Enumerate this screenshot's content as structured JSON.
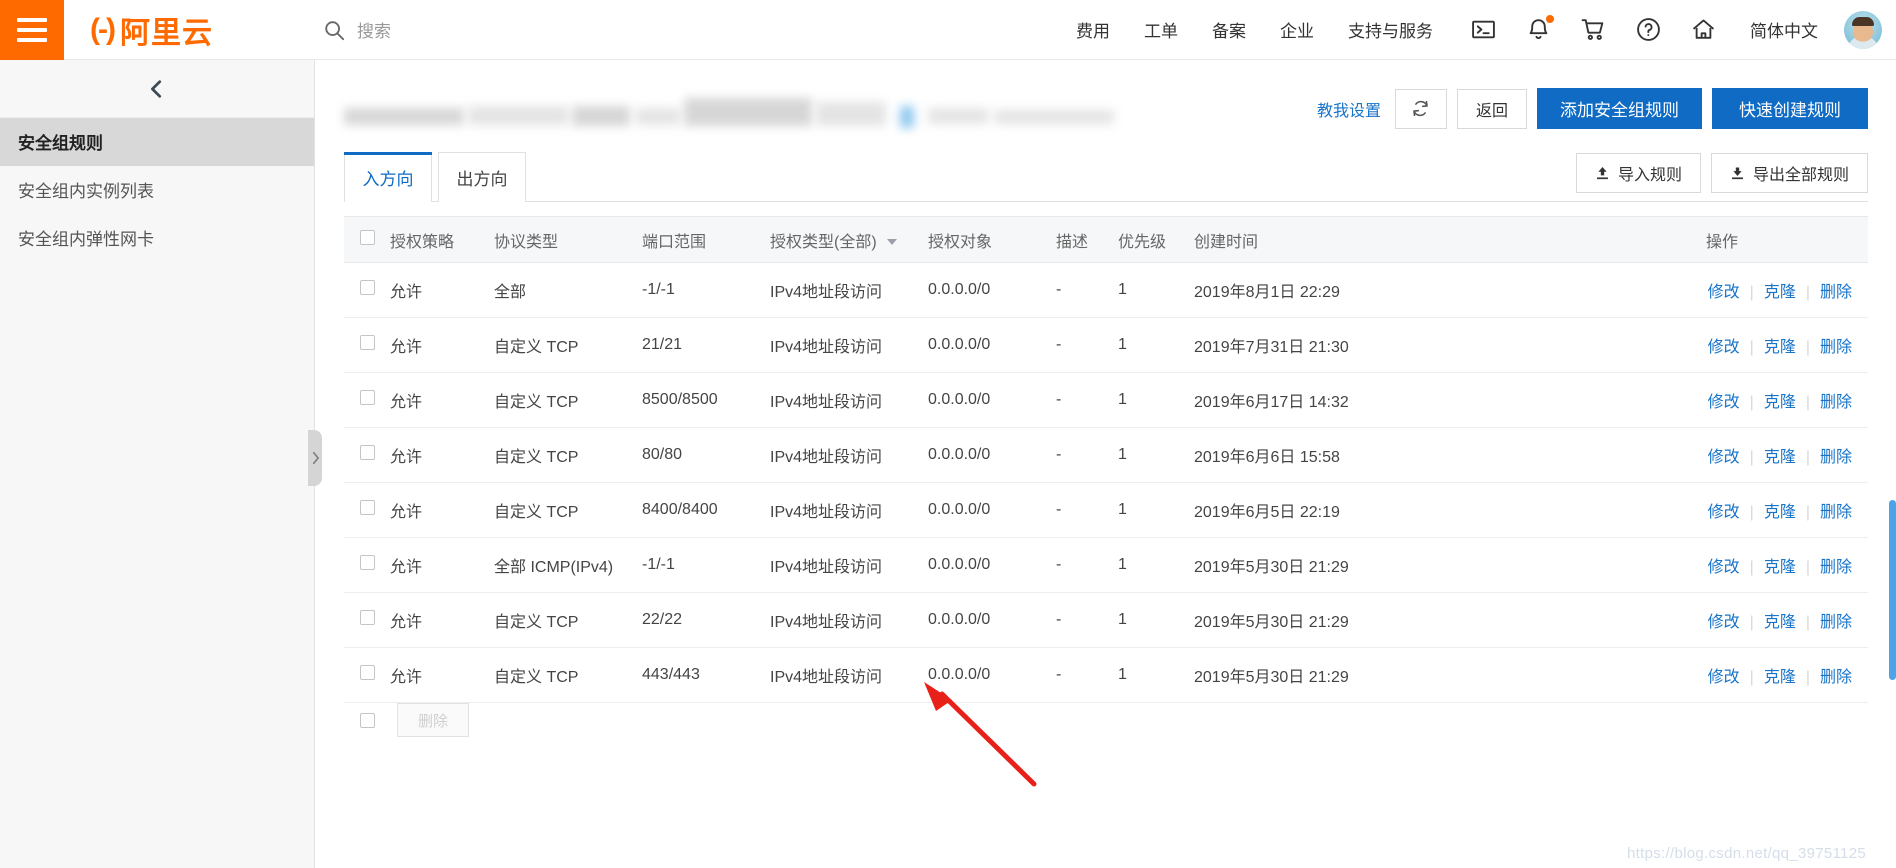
{
  "topbar": {
    "logo_text": "阿里云",
    "logo_mark": "(-)",
    "search_placeholder": "搜索",
    "nav": [
      {
        "label": "费用"
      },
      {
        "label": "工单"
      },
      {
        "label": "备案"
      },
      {
        "label": "企业"
      },
      {
        "label": "支持与服务"
      }
    ],
    "icons": [
      {
        "name": "terminal-icon"
      },
      {
        "name": "bell-icon"
      },
      {
        "name": "cart-icon"
      },
      {
        "name": "help-icon"
      },
      {
        "name": "home-icon"
      }
    ],
    "language": "简体中文"
  },
  "sidebar": {
    "items": [
      {
        "label": "安全组规则",
        "active": true
      },
      {
        "label": "安全组内实例列表",
        "active": false
      },
      {
        "label": "安全组内弹性网卡",
        "active": false
      }
    ]
  },
  "header": {
    "teach_link": "教我设置",
    "refresh_label": "↻",
    "back_label": "返回",
    "add_rule_label": "添加安全组规则",
    "quick_create_label": "快速创建规则"
  },
  "tabs": [
    {
      "label": "入方向",
      "active": true
    },
    {
      "label": "出方向",
      "active": false
    }
  ],
  "toolbar": {
    "import_label": "导入规则",
    "export_label": "导出全部规则"
  },
  "table": {
    "columns": [
      "授权策略",
      "协议类型",
      "端口范围",
      "授权类型(全部)",
      "授权对象",
      "描述",
      "优先级",
      "创建时间",
      "操作"
    ],
    "ops": {
      "edit": "修改",
      "clone": "克隆",
      "delete": "删除"
    },
    "rows": [
      {
        "policy": "允许",
        "protocol": "全部",
        "port": "-1/-1",
        "auth_type": "IPv4地址段访问",
        "auth_obj": "0.0.0.0/0",
        "desc": "-",
        "priority": "1",
        "created": "2019年8月1日 22:29"
      },
      {
        "policy": "允许",
        "protocol": "自定义 TCP",
        "port": "21/21",
        "auth_type": "IPv4地址段访问",
        "auth_obj": "0.0.0.0/0",
        "desc": "-",
        "priority": "1",
        "created": "2019年7月31日 21:30"
      },
      {
        "policy": "允许",
        "protocol": "自定义 TCP",
        "port": "8500/8500",
        "auth_type": "IPv4地址段访问",
        "auth_obj": "0.0.0.0/0",
        "desc": "-",
        "priority": "1",
        "created": "2019年6月17日 14:32"
      },
      {
        "policy": "允许",
        "protocol": "自定义 TCP",
        "port": "80/80",
        "auth_type": "IPv4地址段访问",
        "auth_obj": "0.0.0.0/0",
        "desc": "-",
        "priority": "1",
        "created": "2019年6月6日 15:58"
      },
      {
        "policy": "允许",
        "protocol": "自定义 TCP",
        "port": "8400/8400",
        "auth_type": "IPv4地址段访问",
        "auth_obj": "0.0.0.0/0",
        "desc": "-",
        "priority": "1",
        "created": "2019年6月5日 22:19"
      },
      {
        "policy": "允许",
        "protocol": "全部 ICMP(IPv4)",
        "port": "-1/-1",
        "auth_type": "IPv4地址段访问",
        "auth_obj": "0.0.0.0/0",
        "desc": "-",
        "priority": "1",
        "created": "2019年5月30日 21:29"
      },
      {
        "policy": "允许",
        "protocol": "自定义 TCP",
        "port": "22/22",
        "auth_type": "IPv4地址段访问",
        "auth_obj": "0.0.0.0/0",
        "desc": "-",
        "priority": "1",
        "created": "2019年5月30日 21:29"
      },
      {
        "policy": "允许",
        "protocol": "自定义 TCP",
        "port": "443/443",
        "auth_type": "IPv4地址段访问",
        "auth_obj": "0.0.0.0/0",
        "desc": "-",
        "priority": "1",
        "created": "2019年5月30日 21:29"
      }
    ],
    "cutoff_button_label": "删除"
  },
  "watermark": "https://blog.csdn.net/qq_39751125",
  "colors": {
    "brand_orange": "#ff6a00",
    "primary_blue": "#0f6bc4",
    "link_blue": "#1874c9"
  }
}
